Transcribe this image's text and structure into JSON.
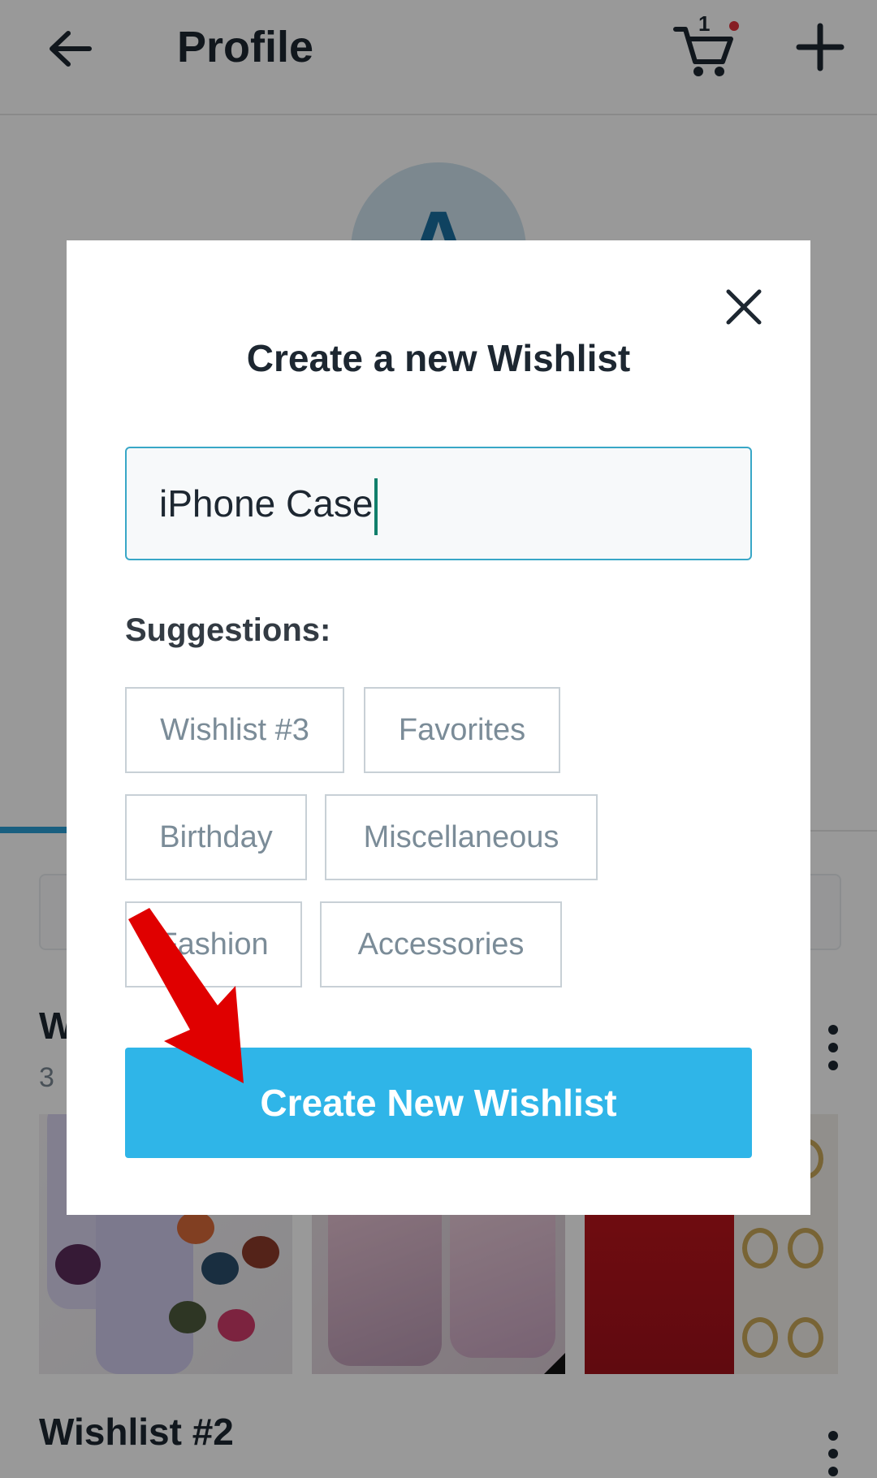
{
  "header": {
    "title": "Profile",
    "cart_count": "1",
    "back_icon": "arrow-left-icon",
    "cart_icon": "cart-icon",
    "add_icon": "plus-icon"
  },
  "profile": {
    "avatar_letter": "A"
  },
  "wishlists": [
    {
      "title": "W",
      "subtitle": "3"
    },
    {
      "title": "Wishlist #2",
      "subtitle": ""
    }
  ],
  "modal": {
    "title": "Create a new Wishlist",
    "input_value": "iPhone Case",
    "suggestions_label": "Suggestions:",
    "suggestions": [
      "Wishlist #3",
      "Favorites",
      "Birthday",
      "Miscellaneous",
      "Fashion",
      "Accessories"
    ],
    "create_button_label": "Create New Wishlist",
    "close_icon": "close-icon"
  },
  "colors": {
    "primary_button": "#2fb5e8",
    "input_border": "#39a7c7",
    "caret": "#117f6b",
    "annotation_arrow": "#e00000",
    "cart_badge_dot": "#e0313b",
    "text_dark": "#1d2731"
  }
}
